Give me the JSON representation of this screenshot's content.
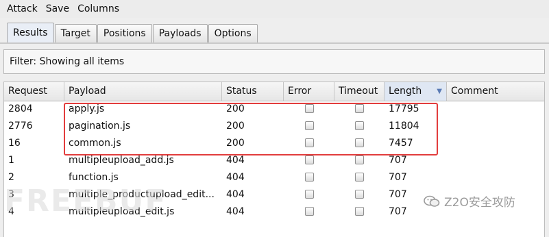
{
  "menu": [
    "Attack",
    "Save",
    "Columns"
  ],
  "tabs": [
    {
      "label": "Results",
      "active": true
    },
    {
      "label": "Target",
      "active": false
    },
    {
      "label": "Positions",
      "active": false
    },
    {
      "label": "Payloads",
      "active": false
    },
    {
      "label": "Options",
      "active": false
    }
  ],
  "filter_text": "Filter: Showing all items",
  "columns": {
    "request": "Request",
    "payload": "Payload",
    "status": "Status",
    "error": "Error",
    "timeout": "Timeout",
    "length": "Length",
    "comment": "Comment"
  },
  "sort": {
    "column": "length",
    "icon": "sort-down-icon"
  },
  "rows": [
    {
      "request": "2804",
      "payload": "apply.js",
      "status": "200",
      "error": false,
      "timeout": false,
      "length": "17795",
      "comment": ""
    },
    {
      "request": "2776",
      "payload": "pagination.js",
      "status": "200",
      "error": false,
      "timeout": false,
      "length": "11804",
      "comment": ""
    },
    {
      "request": "16",
      "payload": "common.js",
      "status": "200",
      "error": false,
      "timeout": false,
      "length": "7457",
      "comment": ""
    },
    {
      "request": "1",
      "payload": "multipleupload_add.js",
      "status": "404",
      "error": false,
      "timeout": false,
      "length": "707",
      "comment": ""
    },
    {
      "request": "2",
      "payload": "function.js",
      "status": "404",
      "error": false,
      "timeout": false,
      "length": "707",
      "comment": ""
    },
    {
      "request": "3",
      "payload": "multiple_productupload_edit...",
      "status": "404",
      "error": false,
      "timeout": false,
      "length": "707",
      "comment": ""
    },
    {
      "request": "4",
      "payload": "multipleupload_edit.js",
      "status": "404",
      "error": false,
      "timeout": false,
      "length": "707",
      "comment": ""
    }
  ],
  "highlight_color": "#e23c3c",
  "watermark_left": "FREEBUF",
  "watermark_right": "Z2O安全攻防"
}
